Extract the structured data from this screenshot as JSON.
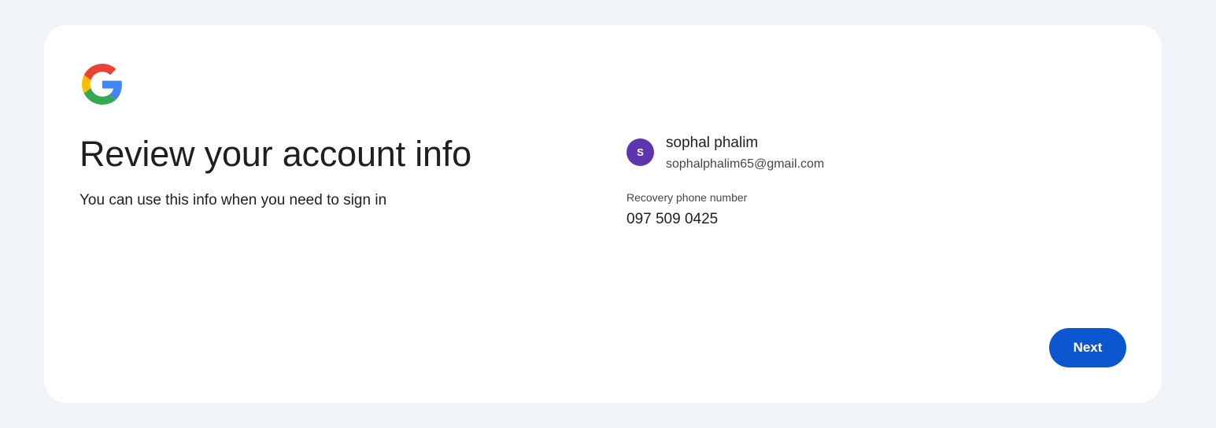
{
  "branding": {
    "logo_icon": "google-g-icon",
    "colors": {
      "red": "#ea4335",
      "yellow": "#fbbc05",
      "green": "#34a853",
      "blue": "#4285f4"
    }
  },
  "main": {
    "title": "Review your account info",
    "subtitle": "You can use this info when you need to sign in"
  },
  "account": {
    "avatar_initial": "S",
    "avatar_color": "#5e35b1",
    "name": "sophal phalim",
    "email": "sophalphalim65@gmail.com"
  },
  "recovery": {
    "label": "Recovery phone number",
    "value": "097 509 0425"
  },
  "actions": {
    "next_label": "Next",
    "next_color": "#0b57d0"
  }
}
